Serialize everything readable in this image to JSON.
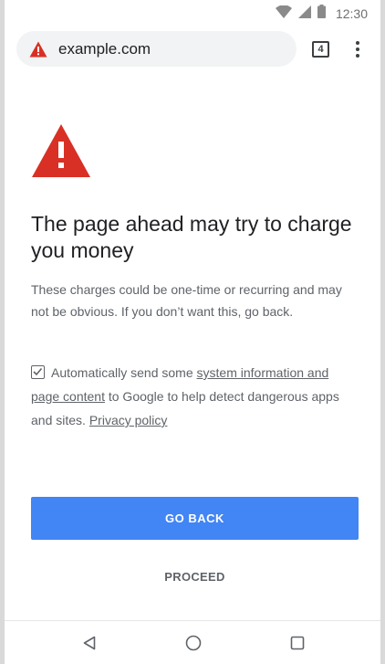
{
  "status_bar": {
    "time": "12:30",
    "icons": [
      "wifi-icon",
      "signal-icon",
      "battery-icon"
    ]
  },
  "toolbar": {
    "url": "example.com",
    "tab_count": "4",
    "security_icon": "warning-triangle-icon",
    "menu_icon": "overflow-menu-icon"
  },
  "interstitial": {
    "heading": "The page ahead may try to charge you money",
    "body": "These charges could be one-time or recurring and may not be obvious. If you don’t want this, go back.",
    "sbox": {
      "checked": true,
      "prefix": "Automatically send some ",
      "link1": "system information and page content",
      "middle": " to Google to help detect dangerous apps and sites. ",
      "link2": "Privacy policy"
    },
    "primary_button": "GO BACK",
    "secondary_button": "PROCEED"
  },
  "nav_bar": {
    "icons": [
      "back-triangle-icon",
      "home-circle-icon",
      "recents-square-icon"
    ]
  },
  "colors": {
    "warning_red": "#d93025",
    "button_blue": "#4285f4",
    "omnibox_bg": "#f1f3f4",
    "text_primary": "#202124",
    "text_secondary": "#5f6368"
  }
}
